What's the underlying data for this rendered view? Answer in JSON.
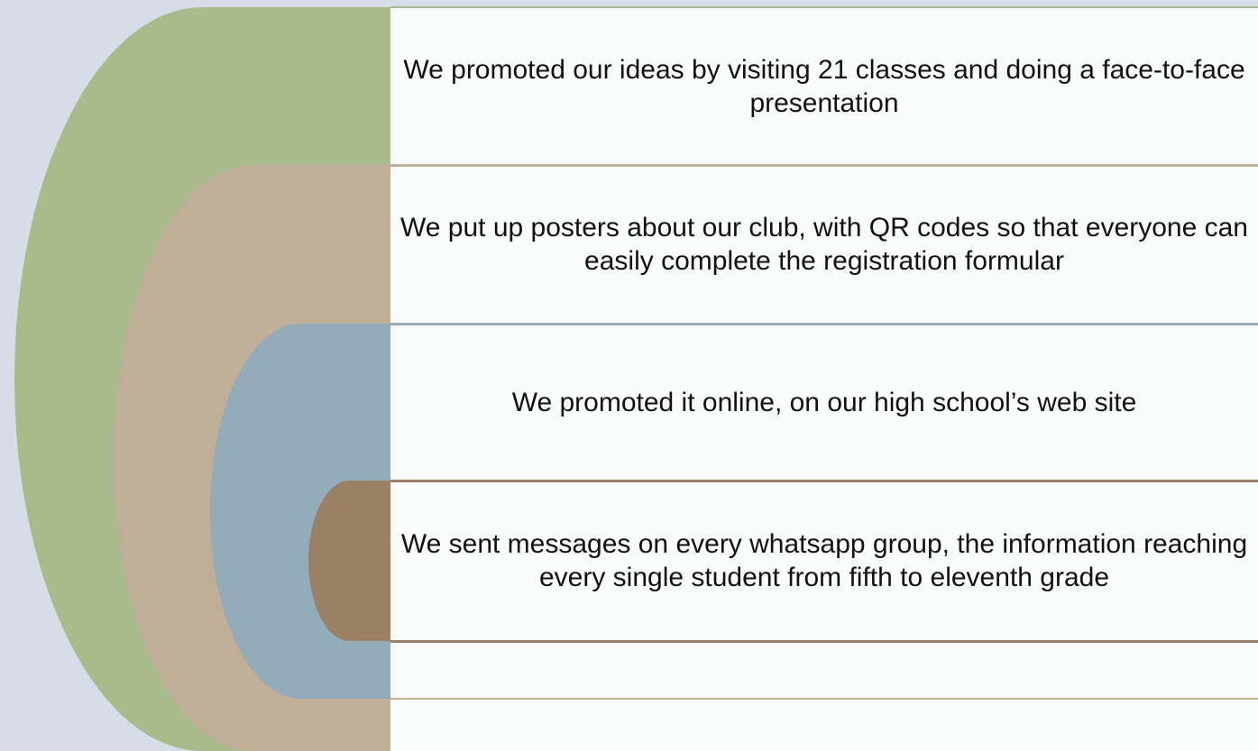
{
  "colors": {
    "background": "#d6dde6",
    "green": "#a9bb8b",
    "tan": "#bfae98",
    "blue": "#93abbb",
    "brown": "#9a8064",
    "panel": "#fafcfb",
    "panel_rule_top": "#a9bb8b",
    "panel_rule_1": "#bfae98",
    "panel_rule_2": "#93abbb",
    "panel_rule_3": "#9a8064"
  },
  "items": [
    {
      "text": "We promoted our ideas by visiting 21 classes and doing a face-to-face presentation"
    },
    {
      "text": "We put up posters about our club, with QR codes so that everyone can easily complete the registration formular"
    },
    {
      "text": "We promoted it online, on our high school’s web site"
    },
    {
      "text": "We sent messages on every whatsapp group, the information reaching every single student from fifth to eleventh grade"
    },
    {
      "text": ""
    },
    {
      "text": ""
    }
  ]
}
